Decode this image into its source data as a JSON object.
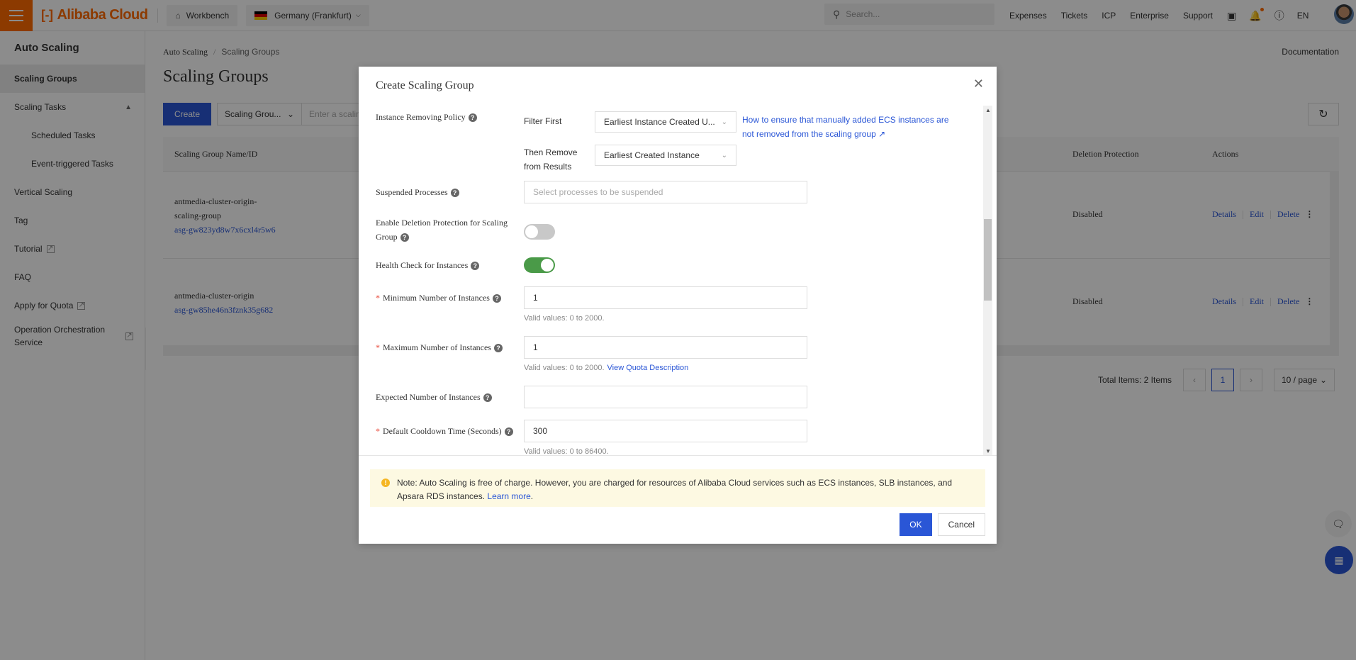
{
  "topbar": {
    "brand": "Alibaba Cloud",
    "workbench": "Workbench",
    "region": "Germany (Frankfurt)",
    "search_placeholder": "Search...",
    "links": [
      "Expenses",
      "Tickets",
      "ICP",
      "Enterprise",
      "Support"
    ],
    "language": "EN",
    "flag_colors": [
      "#000000",
      "#dd0000",
      "#ffce00"
    ]
  },
  "sidebar": {
    "title": "Auto Scaling",
    "items": [
      {
        "label": "Scaling Groups",
        "active": true
      },
      {
        "label": "Scaling Tasks",
        "expanded": true
      },
      {
        "label": "Scheduled Tasks"
      },
      {
        "label": "Event-triggered Tasks"
      },
      {
        "label": "Vertical Scaling"
      },
      {
        "label": "Tag"
      },
      {
        "label": "Tutorial",
        "external": true
      },
      {
        "label": "FAQ"
      },
      {
        "label": "Apply for Quota",
        "external": true
      },
      {
        "label": "Operation Orchestration Service",
        "external": true
      }
    ]
  },
  "main": {
    "breadcrumb": [
      "Auto Scaling",
      "Scaling Groups"
    ],
    "documentation": "Documentation",
    "title": "Scaling Groups",
    "create_label": "Create",
    "filter_select": "Scaling Grou...",
    "search_placeholder": "Enter a scaling",
    "table": {
      "columns": [
        "Scaling Group Name/ID",
        "Deletion Protection",
        "Actions"
      ],
      "rows": [
        {
          "name": "antmedia-cluster-origin-scaling-group",
          "id": "asg-gw823yd8w7x6cxl4r5w6",
          "deletion_protection": "Disabled",
          "actions": [
            "Details",
            "Edit",
            "Delete"
          ]
        },
        {
          "name": "antmedia-cluster-origin",
          "id": "asg-gw85he46n3fznk35g682",
          "deletion_protection": "Disabled",
          "actions": [
            "Details",
            "Edit",
            "Delete"
          ]
        }
      ]
    },
    "pagination": {
      "total": "Total Items: 2 Items",
      "current_page": "1",
      "page_size": "10 / page"
    }
  },
  "modal": {
    "title": "Create Scaling Group",
    "instance_removing_policy": {
      "label": "Instance Removing Policy",
      "filter_first_label": "Filter First",
      "filter_first_value": "Earliest Instance Created U...",
      "then_remove_label": "Then Remove from Results",
      "then_remove_value": "Earliest Created Instance",
      "help_link": "How to ensure that manually added ECS instances are not removed from the scaling group"
    },
    "suspended_processes": {
      "label": "Suspended Processes",
      "placeholder": "Select processes to be suspended"
    },
    "deletion_protection": {
      "label": "Enable Deletion Protection for Scaling Group",
      "enabled": false
    },
    "health_check": {
      "label": "Health Check for Instances",
      "enabled": true
    },
    "min_instances": {
      "label": "Minimum Number of Instances",
      "value": "1",
      "hint": "Valid values: 0 to 2000."
    },
    "max_instances": {
      "label": "Maximum Number of Instances",
      "value": "1",
      "hint": "Valid values: 0 to 2000.",
      "hint_link": "View Quota Description"
    },
    "expected_instances": {
      "label": "Expected Number of Instances",
      "value": ""
    },
    "cooldown": {
      "label": "Default Cooldown Time (Seconds)",
      "value": "300",
      "hint": "Valid values: 0 to 86400."
    },
    "notice": {
      "text": "Note: Auto Scaling is free of charge. However, you are charged for resources of Alibaba Cloud services such as ECS instances, SLB instances, and Apsara RDS instances.",
      "link": "Learn more"
    },
    "ok_label": "OK",
    "cancel_label": "Cancel"
  },
  "colors": {
    "brand": "#ff6a00",
    "primary": "#2a56d6",
    "toggle_on": "#4a9a48",
    "notice_bg": "#fdf9e2"
  }
}
